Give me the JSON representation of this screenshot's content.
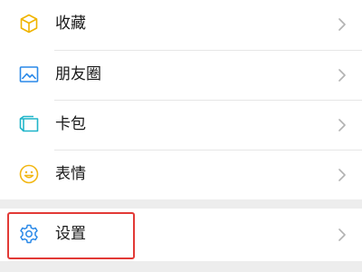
{
  "menu": {
    "items": [
      {
        "label": "收藏",
        "icon": "favorites-cube-icon"
      },
      {
        "label": "朋友圈",
        "icon": "moments-photo-icon"
      },
      {
        "label": "卡包",
        "icon": "card-wallet-icon"
      },
      {
        "label": "表情",
        "icon": "sticker-smile-icon"
      }
    ],
    "settings": {
      "label": "设置",
      "icon": "gear-icon"
    }
  },
  "colors": {
    "background": "#ededed",
    "row": "#ffffff",
    "text": "#191919",
    "divider": "#e6e6e6",
    "chevron": "#b2b2b2",
    "highlight": "#e23a36",
    "favorites_icon": "#f0b400",
    "moments_icon": "#2a89e8",
    "card_icon": "#1fb5c9",
    "sticker_icon": "#f2b713",
    "settings_icon": "#2a89e8"
  }
}
